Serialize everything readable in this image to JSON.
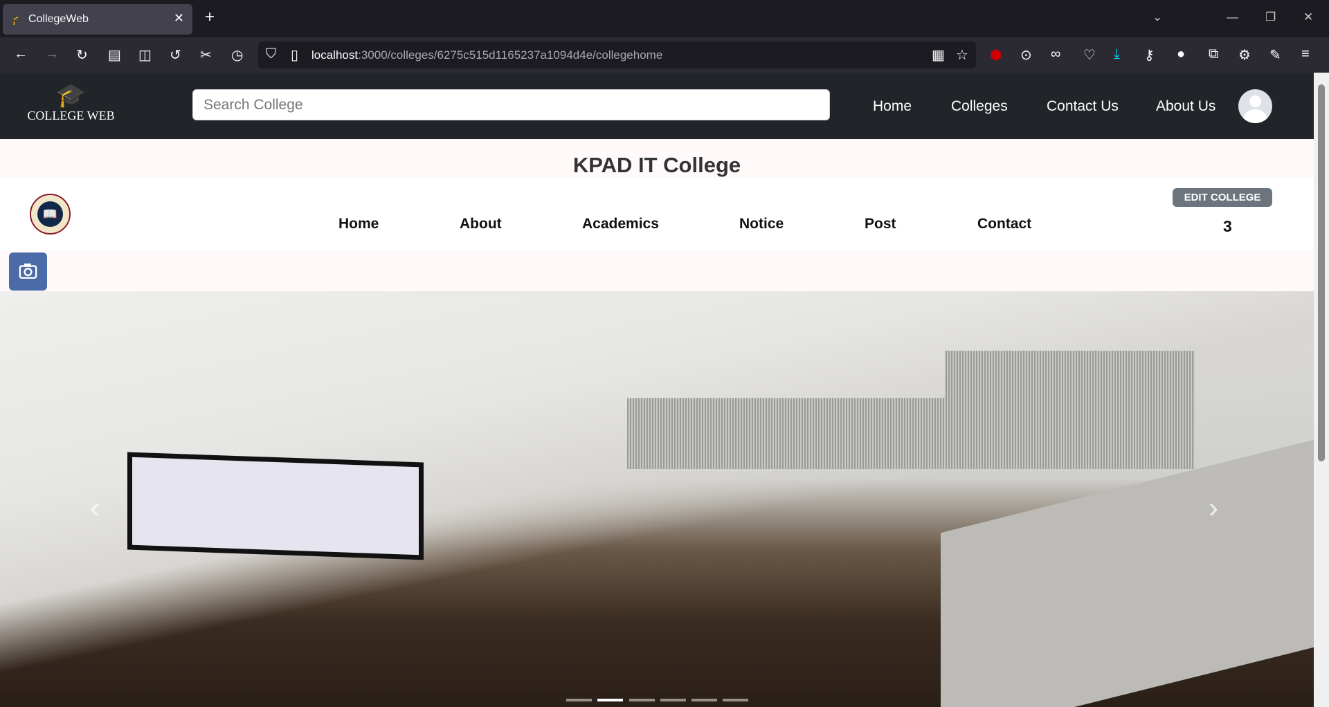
{
  "browser": {
    "tab_title": "CollegeWeb",
    "url_host": "localhost",
    "url_path": ":3000/colleges/6275c515d1165237a1094d4e/collegehome"
  },
  "header": {
    "logo_text": "COLLEGE WEB",
    "search_placeholder": "Search College",
    "nav": [
      "Home",
      "Colleges",
      "Contact Us",
      "About Us"
    ]
  },
  "college": {
    "name": "KPAD IT College",
    "nav": [
      "Home",
      "About",
      "Academics",
      "Notice",
      "Post",
      "Contact"
    ],
    "edit_label": "EDIT COLLEGE",
    "count": "3"
  },
  "carousel": {
    "slides": 6,
    "active": 1
  }
}
